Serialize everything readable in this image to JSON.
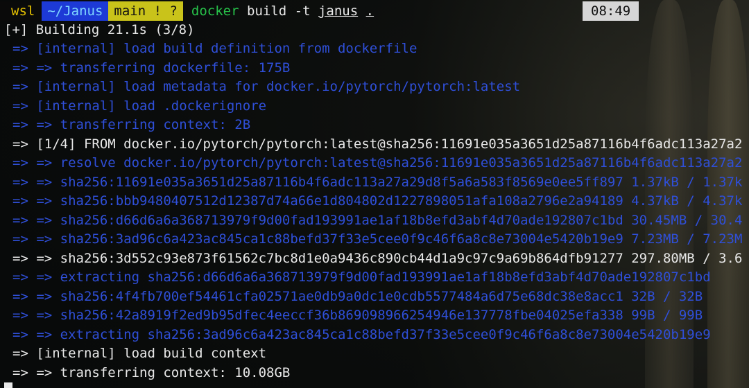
{
  "prompt": {
    "host": "wsl",
    "dir": "~/Janus",
    "git": "main ! ?",
    "command_name": "docker",
    "command_args_a": "build -t",
    "command_tag": "janus",
    "command_context": "."
  },
  "clock": "08:49",
  "status_line": "[+] Building 21.1s (3/8)",
  "lines": [
    {
      "text": "=> [internal] load build definition from dockerfile",
      "color": "#2f4fd8"
    },
    {
      "text": "=> => transferring dockerfile: 175B",
      "color": "#2f4fd8"
    },
    {
      "text": "=> [internal] load metadata for docker.io/pytorch/pytorch:latest",
      "color": "#2f4fd8"
    },
    {
      "text": "=> [internal] load .dockerignore",
      "color": "#2f4fd8"
    },
    {
      "text": "=> => transferring context: 2B",
      "color": "#2f4fd8"
    },
    {
      "text": "=> [1/4] FROM docker.io/pytorch/pytorch:latest@sha256:11691e035a3651d25a87116b4f6adc113a27a2",
      "color": "#e8e8e8"
    },
    {
      "text": "=> => resolve docker.io/pytorch/pytorch:latest@sha256:11691e035a3651d25a87116b4f6adc113a27a2",
      "color": "#2f4fd8"
    },
    {
      "text": "=> => sha256:11691e035a3651d25a87116b4f6adc113a27a29d8f5a6a583f8569e0ee5ff897 1.37kB / 1.37k",
      "color": "#2f4fd8"
    },
    {
      "text": "=> => sha256:bbb9480407512d12387d74a66e1d804802d1227898051afa108a2796e2a94189 4.37kB / 4.37k",
      "color": "#2f4fd8"
    },
    {
      "text": "=> => sha256:d66d6a6a368713979f9d00fad193991ae1af18b8efd3abf4d70ade192807c1bd 30.45MB / 30.4",
      "color": "#2f4fd8"
    },
    {
      "text": "=> => sha256:3ad96c6a423ac845ca1c88befd37f33e5cee0f9c46f6a8c8e73004e5420b19e9 7.23MB / 7.23M",
      "color": "#2f4fd8"
    },
    {
      "text": "=> => sha256:3d552c93e873f61562c7bc8d1e0a9436c890cb44d1a9c97c9a69b864dfb91277 297.80MB / 3.6",
      "color": "#e8e8e8"
    },
    {
      "text": "=> => extracting sha256:d66d6a6a368713979f9d00fad193991ae1af18b8efd3abf4d70ade192807c1bd",
      "color": "#2f4fd8"
    },
    {
      "text": "=> => sha256:4f4fb700ef54461cfa02571ae0db9a0dc1e0cdb5577484a6d75e68dc38e8acc1 32B / 32B",
      "color": "#2f4fd8"
    },
    {
      "text": "=> => sha256:42a8919f2ed9b95dfec4eeccf36b869098966254946e137778fbe04025efa338 99B / 99B",
      "color": "#2f4fd8"
    },
    {
      "text": "=> => extracting sha256:3ad96c6a423ac845ca1c88befd37f33e5cee0f9c46f6a8c8e73004e5420b19e9",
      "color": "#2f4fd8"
    },
    {
      "text": "=> [internal] load build context",
      "color": "#e8e8e8"
    },
    {
      "text": "=> => transferring context: 10.08GB",
      "color": "#e8e8e8"
    }
  ],
  "colors": {
    "blue_text": "#2f4fd8",
    "white_text": "#e8e8e8",
    "prompt_host_fg": "#e6c200",
    "prompt_dir_bg": "#1d3ad6",
    "prompt_git_bg": "#c9c31a",
    "command_green": "#27c24a",
    "clock_bg": "#d6d6d6"
  }
}
